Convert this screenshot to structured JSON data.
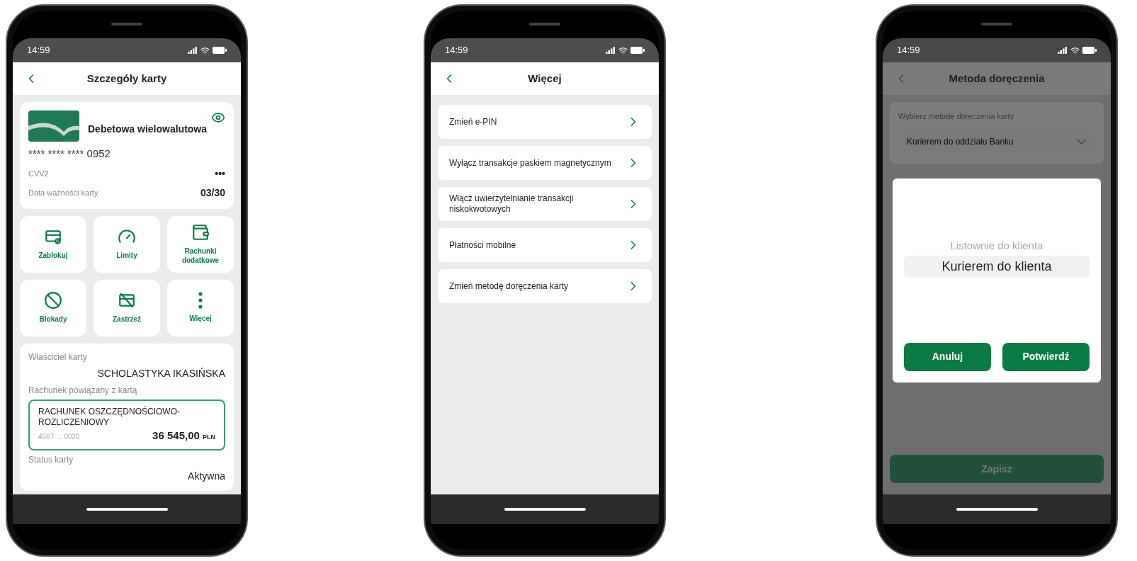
{
  "phones": [
    {
      "kind": "card_details",
      "status_bar": {
        "time": "14:59"
      },
      "header": {
        "title": "Szczegóły karty"
      },
      "card": {
        "name": "Debetowa wielowalutowa",
        "number": "**** **** **** 0952",
        "fields": [
          {
            "label": "CVV2",
            "value": "•••"
          },
          {
            "label": "Data ważności karty",
            "value": "03/30"
          }
        ]
      },
      "actions": [
        {
          "label": "Zablokuj"
        },
        {
          "label": "Limity"
        },
        {
          "label": "Rachunki dodatkowe"
        },
        {
          "label": "Blokady"
        },
        {
          "label": "Zastrzeż"
        },
        {
          "label": "Więcej"
        }
      ],
      "details": {
        "owner_label": "Właściciel karty",
        "owner": "SCHOLASTYKA IKASIŃSKA",
        "account_label": "Rachunek powiązany z kartą",
        "account": {
          "name": "RACHUNEK OSZCZĘDNOŚCIOWO-ROZLICZENIOWY",
          "number": "4587 ... 0020",
          "amount": "36 545,00",
          "currency": "PLN"
        },
        "status_label": "Status karty",
        "status": "Aktywna"
      }
    },
    {
      "kind": "menu",
      "status_bar": {
        "time": "14:59"
      },
      "header": {
        "title": "Więcej"
      },
      "items": [
        {
          "label": "Zmień e-PIN"
        },
        {
          "label": "Wyłącz transakcje paskiem magnetycznym"
        },
        {
          "label": "Włącz uwierzytelnianie transakcji niskokwotowych"
        },
        {
          "label": "Płatności mobilne"
        },
        {
          "label": "Zmień metodę doręczenia karty"
        }
      ]
    },
    {
      "kind": "delivery",
      "status_bar": {
        "time": "14:59"
      },
      "header": {
        "title": "Metoda doręczenia"
      },
      "field": {
        "label": "Wybierz metodę doręczenia karty",
        "value": "Kurierem do oddziału Banku"
      },
      "picker": {
        "options": [
          {
            "label": "Listownie do klienta",
            "selected": false
          },
          {
            "label": "Kurierem do klienta",
            "selected": true
          }
        ],
        "buttons": [
          "Anuluj",
          "Potwierdź"
        ]
      },
      "save_button": "Zapisz"
    }
  ]
}
